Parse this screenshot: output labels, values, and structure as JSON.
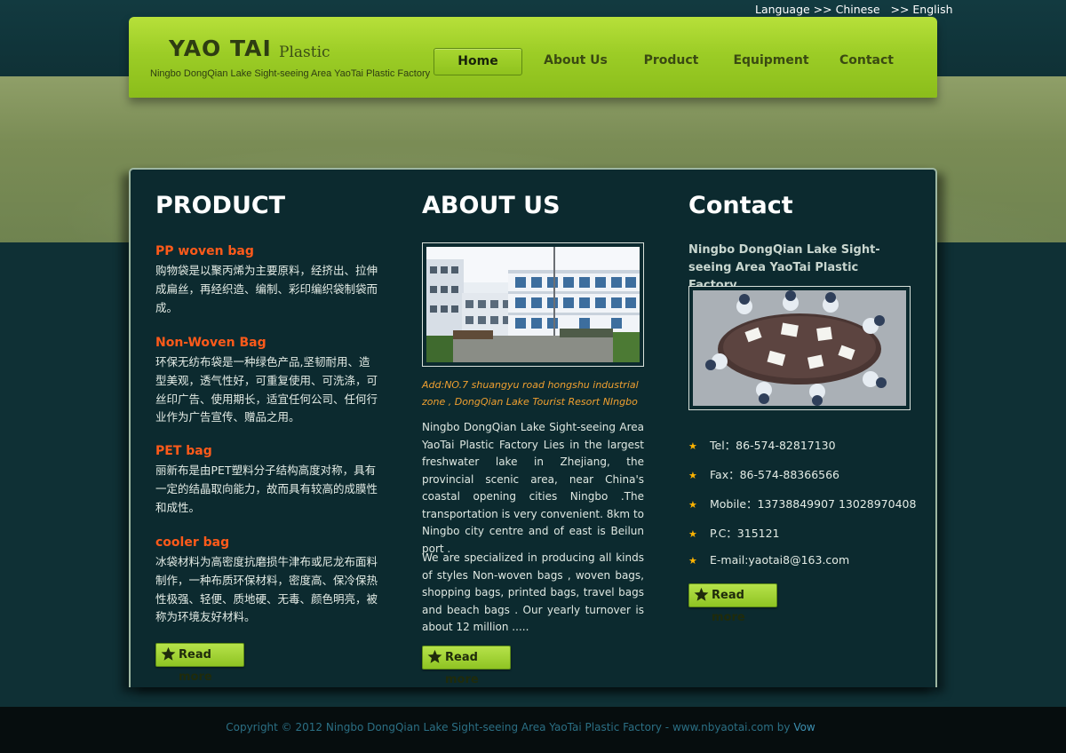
{
  "language": {
    "label": "Language >> ",
    "chinese": "Chinese",
    "sep": "   >> ",
    "english": "English"
  },
  "header": {
    "logo_title": "YAO TAI",
    "logo_sub": "Plastic",
    "tagline": "Ningbo DongQian Lake Sight-seeing Area YaoTai Plastic Factory",
    "nav": [
      {
        "label": "Home",
        "active": true
      },
      {
        "label": "About Us"
      },
      {
        "label": "Product"
      },
      {
        "label": "Equipment"
      },
      {
        "label": "Contact"
      }
    ]
  },
  "product": {
    "title": "PRODUCT",
    "items": [
      {
        "name": "PP woven bag",
        "desc": "购物袋是以聚丙烯为主要原料，经挤出、拉伸成扁丝，再经织造、编制、彩印编织袋制袋而成。"
      },
      {
        "name": "Non-Woven Bag",
        "desc": "环保无纺布袋是一种绿色产品,坚韧耐用、造型美观，透气性好，可重复使用、可洗涤，可丝印广告、使用期长，适宜任何公司、任何行业作为广告宣传、赠品之用。"
      },
      {
        "name": "PET bag",
        "desc": "丽新布是由PET塑料分子结构高度对称，具有一定的结晶取向能力，故而具有较高的成膜性和成性。"
      },
      {
        "name": "cooler bag",
        "desc": "冰袋材料为高密度抗磨损牛津布或尼龙布面料制作，一种布质环保材料，密度高、保冷保热性极强、轻便、质地硬、无毒、颜色明亮，被称为环境友好材料。"
      }
    ],
    "read_more": "Read more"
  },
  "about": {
    "title": "ABOUT US",
    "address": "Add:NO.7 shuangyu road hongshu industrial zone , DongQian Lake Tourist Resort NIngbo",
    "para1": "Ningbo DongQian Lake Sight-seeing Area YaoTai Plastic Factory Lies in the largest freshwater lake in Zhejiang, the provincial scenic area, near China's coastal opening cities Ningbo .The transportation is very convenient. 8km to Ningbo city centre and of east is Beilun port .",
    "para2": "We are specialized in producing all kinds of styles Non-woven bags , woven bags, shopping bags, printed bags, travel bags and beach bags . Our yearly turnover is about 12 million .....",
    "read_more": "Read more"
  },
  "contact": {
    "title": "Contact",
    "company": "Ningbo DongQian Lake Sight-seeing Area YaoTai Plastic Factory",
    "rows": [
      "Tel：86-574-82817130",
      "Fax：86-574-88366566",
      "Mobile：13738849907 13028970408",
      "P.C：315121",
      "E-mail:yaotai8@163.com"
    ],
    "read_more": "Read more"
  },
  "footer": {
    "copyright": "Copyright © 2012 Ningbo DongQian Lake Sight-seeing Area YaoTai Plastic Factory - www.nbyaotai.com by ",
    "vow": "Vow"
  },
  "colors": {
    "accent_green": "#9ccd26",
    "heading_orange": "#ff5a1a",
    "address_orange": "#f0a030",
    "bullet_star": "#ffb400",
    "panel_bg": "#0c2a2f",
    "footer_link": "#2b6f84"
  },
  "icons": {
    "readmore": "star-icon",
    "bullet": "star-bullet-icon"
  }
}
